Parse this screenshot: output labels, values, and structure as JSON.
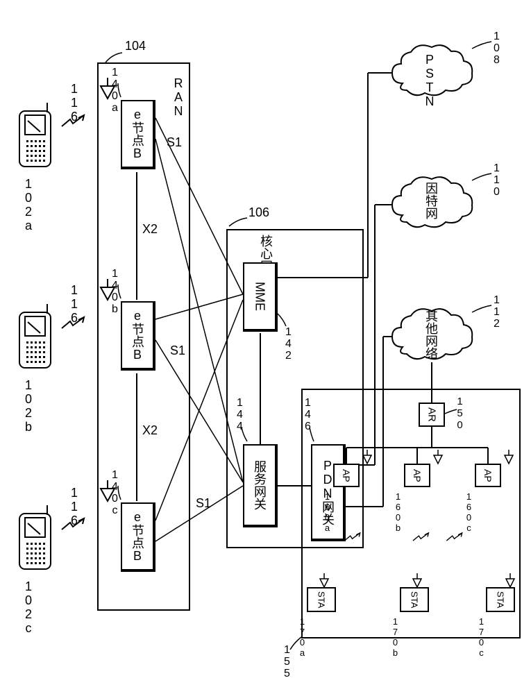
{
  "ue": {
    "a": "102a",
    "b": "102b",
    "c": "102c"
  },
  "rf": "116",
  "ran": {
    "label": "RAN",
    "ref": "104",
    "enb": {
      "label": "e节点B",
      "a": "140a",
      "b": "140b",
      "c": "140c"
    },
    "links": {
      "s1": "S1",
      "x2": "X2"
    }
  },
  "core": {
    "label": "核心网",
    "ref": "106",
    "mme": {
      "label": "MME",
      "ref": "142"
    },
    "sgw": {
      "label": "服务网关",
      "ref": "144"
    },
    "pgw": {
      "label": "PDN网关",
      "ref": "146"
    }
  },
  "clouds": {
    "pstn": {
      "label": "PSTN",
      "ref": "108"
    },
    "internet": {
      "label": "因特网",
      "ref": "110"
    },
    "other": {
      "label": "其他网络",
      "ref": "112"
    }
  },
  "wlan": {
    "ref": "155",
    "ar": {
      "label": "AR",
      "ref": "150"
    },
    "ap": {
      "label": "AP",
      "a": "160a",
      "b": "160b",
      "c": "160c"
    },
    "sta": {
      "label": "STA",
      "a": "170a",
      "b": "170b",
      "c": "170c"
    }
  }
}
